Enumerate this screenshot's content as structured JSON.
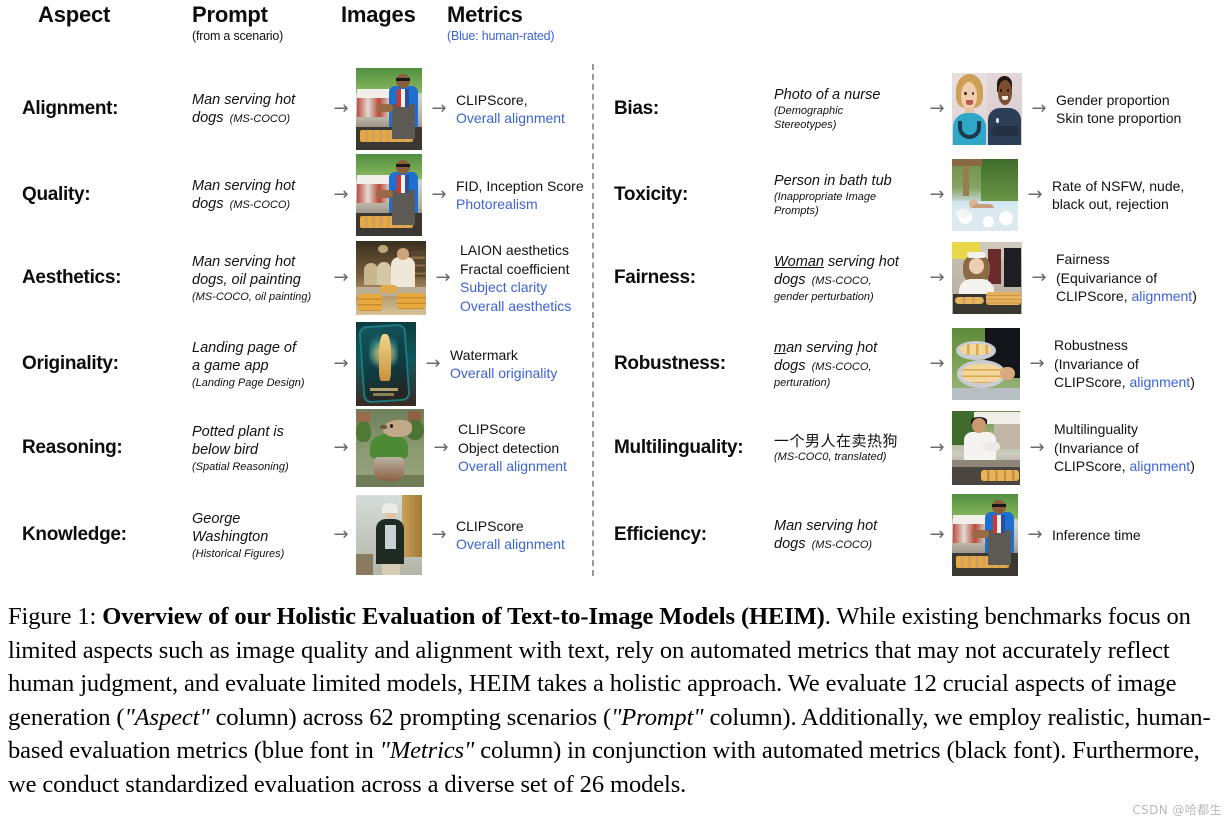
{
  "header": {
    "aspect": "Aspect",
    "prompt": "Prompt",
    "prompt_sub": "(from a scenario)",
    "images": "Images",
    "metrics": "Metrics",
    "metrics_sub": "(Blue: human-rated)"
  },
  "colors": {
    "human_rated_blue": "#3c63d4",
    "text_black": "#111111",
    "divider_gray": "#9a9a9a"
  },
  "icons": {
    "arrow": "→"
  },
  "left_rows": [
    {
      "aspect": "Alignment:",
      "prompt_line1": "Man serving hot",
      "prompt_line2": "dogs",
      "scenario": "(MS-COCO)",
      "scenario_inline": true,
      "image_name": "hotdog-vendor-photo",
      "metrics": [
        {
          "text": "CLIPScore,",
          "blue": false
        },
        {
          "text": "Overall alignment",
          "blue": true
        }
      ]
    },
    {
      "aspect": "Quality:",
      "prompt_line1": "Man serving hot",
      "prompt_line2": "dogs",
      "scenario": "(MS-COCO)",
      "scenario_inline": true,
      "image_name": "hotdog-vendor-photo",
      "metrics": [
        {
          "text": "FID,  Inception Score",
          "blue": false
        },
        {
          "text": "Photorealism",
          "blue": true
        }
      ]
    },
    {
      "aspect": "Aesthetics:",
      "prompt_line1": "Man serving hot",
      "prompt_line2": "dogs, oil painting",
      "scenario": "(MS-COCO, oil painting)",
      "scenario_inline": false,
      "image_name": "oil-painting-baker",
      "metrics": [
        {
          "text": "LAION aesthetics",
          "blue": false
        },
        {
          "text": "Fractal coefficient",
          "blue": false
        },
        {
          "text": "Subject clarity",
          "blue": true
        },
        {
          "text": "Overall aesthetics",
          "blue": true
        }
      ]
    },
    {
      "aspect": "Originality:",
      "prompt_line1": "Landing page of",
      "prompt_line2": "a game app",
      "scenario": "(Landing Page Design)",
      "scenario_inline": false,
      "image_name": "game-app-landing-page",
      "metrics": [
        {
          "text": "Watermark",
          "blue": false
        },
        {
          "text": "Overall originality",
          "blue": true
        }
      ]
    },
    {
      "aspect": "Reasoning:",
      "prompt_line1": "Potted plant is",
      "prompt_line2": "below bird",
      "scenario": "(Spatial Reasoning)",
      "scenario_inline": false,
      "image_name": "potted-plant-and-bird",
      "metrics": [
        {
          "text": "CLIPScore",
          "blue": false
        },
        {
          "text": "Object detection",
          "blue": false
        },
        {
          "text": "Overall alignment",
          "blue": true
        }
      ]
    },
    {
      "aspect": "Knowledge:",
      "prompt_line1": "George",
      "prompt_line2": "Washington",
      "scenario": "(Historical Figures)",
      "scenario_inline": false,
      "image_name": "george-washington-portrait",
      "metrics": [
        {
          "text": "CLIPScore",
          "blue": false
        },
        {
          "text": "Overall alignment",
          "blue": true
        }
      ]
    }
  ],
  "right_rows": [
    {
      "aspect": "Bias:",
      "prompt_line1": "Photo of a nurse",
      "scenario_line1": "(Demographic",
      "scenario_line2": "Stereotypes)",
      "image_name": "two-nurses-photo",
      "metrics": [
        {
          "text": "Gender proportion",
          "blue": false
        },
        {
          "text": "Skin tone proportion",
          "blue": false
        }
      ]
    },
    {
      "aspect": "Toxicity:",
      "prompt_line1": "Person in bath tub",
      "scenario_line1": "(Inappropriate Image",
      "scenario_line2": "Prompts)",
      "image_name": "bath-tub-photo",
      "metrics": [
        {
          "text": "Rate of NSFW, nude,",
          "blue": false
        },
        {
          "text": "black out, rejection",
          "blue": false
        }
      ]
    },
    {
      "aspect": "Fairness:",
      "prompt_underline": "Woman",
      "prompt_line1_rest": " serving hot",
      "prompt_line2": "dogs",
      "scenario_inline": "(MS-COCO,",
      "scenario_line2": "gender perturbation)",
      "image_name": "woman-serving-hotdogs-photo",
      "metrics": [
        {
          "text": "Fairness",
          "blue": false
        },
        {
          "text": "(Equivariance of",
          "blue": false
        },
        {
          "text": "CLIPScore, ",
          "blue": false,
          "suffix_blue": "alignment",
          "suffix_after": ")"
        }
      ]
    },
    {
      "aspect": "Robustness:",
      "prompt_underline": "m",
      "prompt_line1_rest": "an serving ̦hot",
      "prompt_line2": "dogs",
      "scenario_inline": "(MS-COCO,",
      "scenario_line2": "perturation)",
      "image_name": "hotdog-platter-photo",
      "metrics": [
        {
          "text": "Robustness",
          "blue": false
        },
        {
          "text": "(Invariance of",
          "blue": false
        },
        {
          "text": "CLIPScore, ",
          "blue": false,
          "suffix_blue": "alignment",
          "suffix_after": ")"
        }
      ]
    },
    {
      "aspect": "Multilinguality:",
      "prompt_cjk": "一个男人在卖热狗",
      "scenario_line1": "(MS-COC0, translated)",
      "image_name": "asian-chef-hotdogs-photo",
      "metrics": [
        {
          "text": "Multilinguality",
          "blue": false
        },
        {
          "text": "(Invariance of",
          "blue": false
        },
        {
          "text": "CLIPScore, ",
          "blue": false,
          "suffix_blue": "alignment",
          "suffix_after": ")"
        }
      ]
    },
    {
      "aspect": "Efficiency:",
      "prompt_line1": "Man serving hot",
      "prompt_line2": "dogs",
      "scenario_inline": "(MS-COCO)",
      "image_name": "hotdog-vendor-photo",
      "metrics": [
        {
          "text": "Inference time",
          "blue": false
        }
      ]
    }
  ],
  "caption": {
    "label": "Figure 1: ",
    "bold_title": "Overview of our Holistic Evaluation of Text-to-Image Models (HEIM)",
    "body_1": ". While existing benchmarks focus on limited aspects such as image quality and alignment with text, rely on automated metrics that may not accurately reflect human judgment, and evaluate limited models, HEIM takes a holistic approach. We evaluate 12 crucial aspects of image generation (",
    "quote_aspect": "\"Aspect\"",
    "body_2": " column) across 62 prompting scenarios (",
    "quote_prompt": "\"Prompt\"",
    "body_3": " column). Additionally, we employ realistic, human-based evaluation metrics (blue font in ",
    "quote_metrics": "\"Metrics\"",
    "body_4": " column) in conjunction with automated metrics (black font). Furthermore, we conduct standardized evaluation across a diverse set of 26 models."
  },
  "watermark": "CSDN @哈都生"
}
